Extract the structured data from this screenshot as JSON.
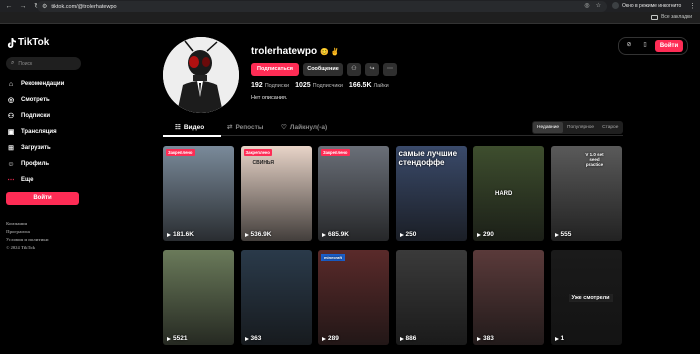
{
  "browser": {
    "url": "tiktok.com/@trolerhatewpo",
    "incognito_label": "Окно в режиме инкогнито",
    "bookmarks_all": "Все закладки"
  },
  "sidebar": {
    "logo": "TikTok",
    "search_placeholder": "Поиск",
    "items": [
      {
        "label": "Рекомендации",
        "icon": "home-icon"
      },
      {
        "label": "Смотреть",
        "icon": "compass-icon"
      },
      {
        "label": "Подписки",
        "icon": "users-icon"
      },
      {
        "label": "Трансляция",
        "icon": "live-icon"
      },
      {
        "label": "Загрузить",
        "icon": "upload-icon"
      },
      {
        "label": "Профиль",
        "icon": "profile-icon"
      },
      {
        "label": "Еще",
        "icon": "more-dots-icon"
      }
    ],
    "login": "Войти",
    "footer": [
      "Компания",
      "Программа",
      "Условия и политики",
      "© 2024 TikTok"
    ]
  },
  "top_actions": {
    "login": "Войти"
  },
  "profile": {
    "username": "trolerhatewpo",
    "emojis": "😊 ✌",
    "subscribe": "Подписаться",
    "message": "Сообщение",
    "stats": [
      {
        "value": "192",
        "label": "Подписки"
      },
      {
        "value": "1025",
        "label": "Подписчики"
      },
      {
        "value": "166.5K",
        "label": "Лайки"
      }
    ],
    "bio": "Нет описания."
  },
  "tabs": [
    {
      "label": "Видео"
    },
    {
      "label": "Репосты"
    },
    {
      "label": "Лайкнул(-а)"
    }
  ],
  "sort": [
    "Недавние",
    "Популярное",
    "Старое"
  ],
  "videos": [
    {
      "views": "181.6K",
      "badge": "Закреплено",
      "bg": "#7a8a9a"
    },
    {
      "views": "536.9K",
      "badge": "Закреплено",
      "bg": "#e8d4c8",
      "caption": "СВИНЬЯ"
    },
    {
      "views": "685.9K",
      "badge": "Закреплено",
      "bg": "#6a6f78"
    },
    {
      "views": "250",
      "bg": "#3a4a6a",
      "caption": "самые лучшие стендоффе"
    },
    {
      "views": "290",
      "bg": "#3e4e2e",
      "caption": "HARD"
    },
    {
      "views": "555",
      "bg": "#5a5a5a",
      "caption": "V 1.0 set seed practice"
    },
    {
      "views": "5521",
      "bg": "#6a7a5a"
    },
    {
      "views": "363",
      "bg": "#2a3a4a"
    },
    {
      "views": "289",
      "bg": "#5a2a2a",
      "caption": "minecraft"
    },
    {
      "views": "886",
      "bg": "#3a3a3a"
    },
    {
      "views": "383",
      "bg": "#5a3a3a"
    },
    {
      "views": "1",
      "bg": "#1a1a1a",
      "caption": "Уже смотрели"
    }
  ]
}
